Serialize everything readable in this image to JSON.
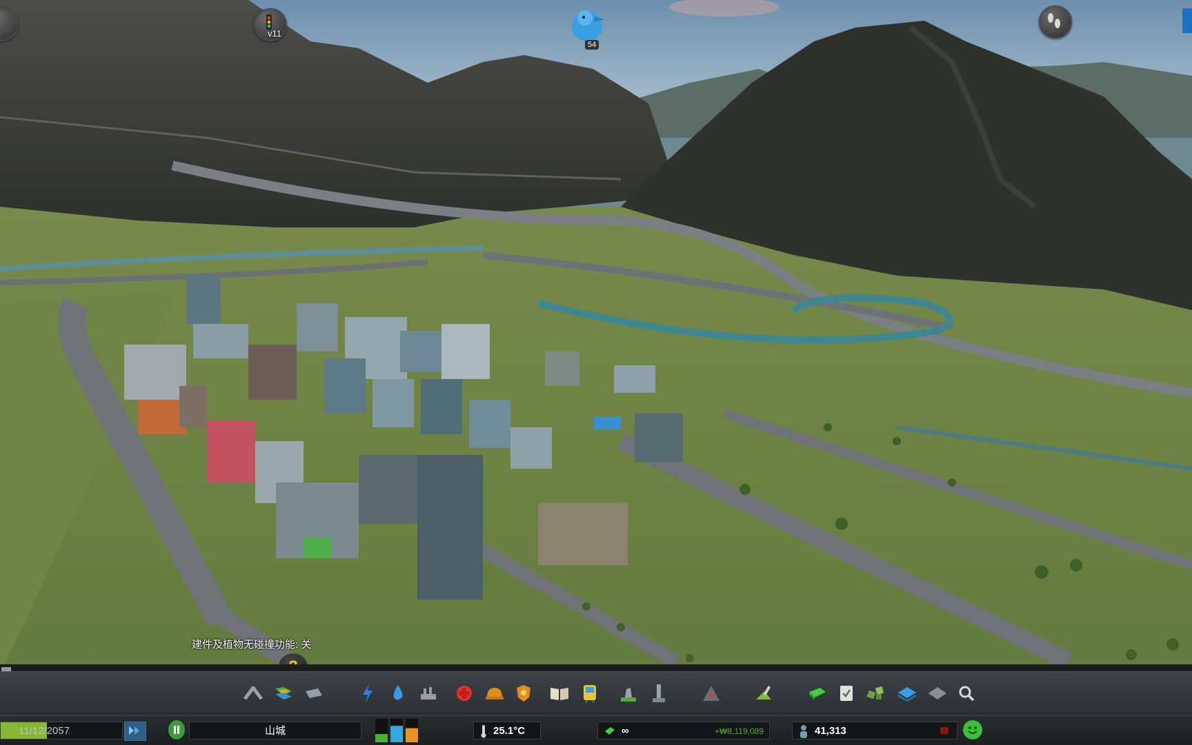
{
  "overlay": {
    "traffic_mod_version": "v11",
    "chirper_count": "54",
    "collision_status": "建件及植物无碰撞功能: 关"
  },
  "help_button": {
    "label": "?"
  },
  "toolbar": {
    "tools": [
      {
        "name": "roads-tool-icon"
      },
      {
        "name": "zoning-tool-icon"
      },
      {
        "name": "districts-tool-icon"
      },
      {
        "name": "electricity-tool-icon"
      },
      {
        "name": "water-tool-icon"
      },
      {
        "name": "garbage-tool-icon"
      },
      {
        "name": "healthcare-tool-icon"
      },
      {
        "name": "fire-department-tool-icon"
      },
      {
        "name": "police-tool-icon"
      },
      {
        "name": "education-tool-icon"
      },
      {
        "name": "public-transport-tool-icon"
      },
      {
        "name": "beautification-tool-icon"
      },
      {
        "name": "monuments-tool-icon"
      },
      {
        "name": "wonders-tool-icon"
      },
      {
        "name": "landscaping-tool-icon"
      },
      {
        "name": "money-tool-icon"
      },
      {
        "name": "policies-tool-icon"
      },
      {
        "name": "areas-tool-icon"
      },
      {
        "name": "layers-tool-icon"
      },
      {
        "name": "bulldozer-tool-icon"
      },
      {
        "name": "search-icon"
      }
    ]
  },
  "infobar": {
    "date": "11/12/2057",
    "date_progress": 0.38,
    "city_name": "山城",
    "temperature": "25.1°C",
    "money": "∞",
    "income": "+₩8,119,089",
    "population": "41,313",
    "demand": {
      "residential": 0.35,
      "commercial": 0.7,
      "industrial": 0.6
    }
  },
  "colors": {
    "happiness": "#39c03c",
    "residential_demand": "#4caf3a",
    "commercial_demand": "#33a8e0",
    "industrial_demand": "#e8921f"
  }
}
